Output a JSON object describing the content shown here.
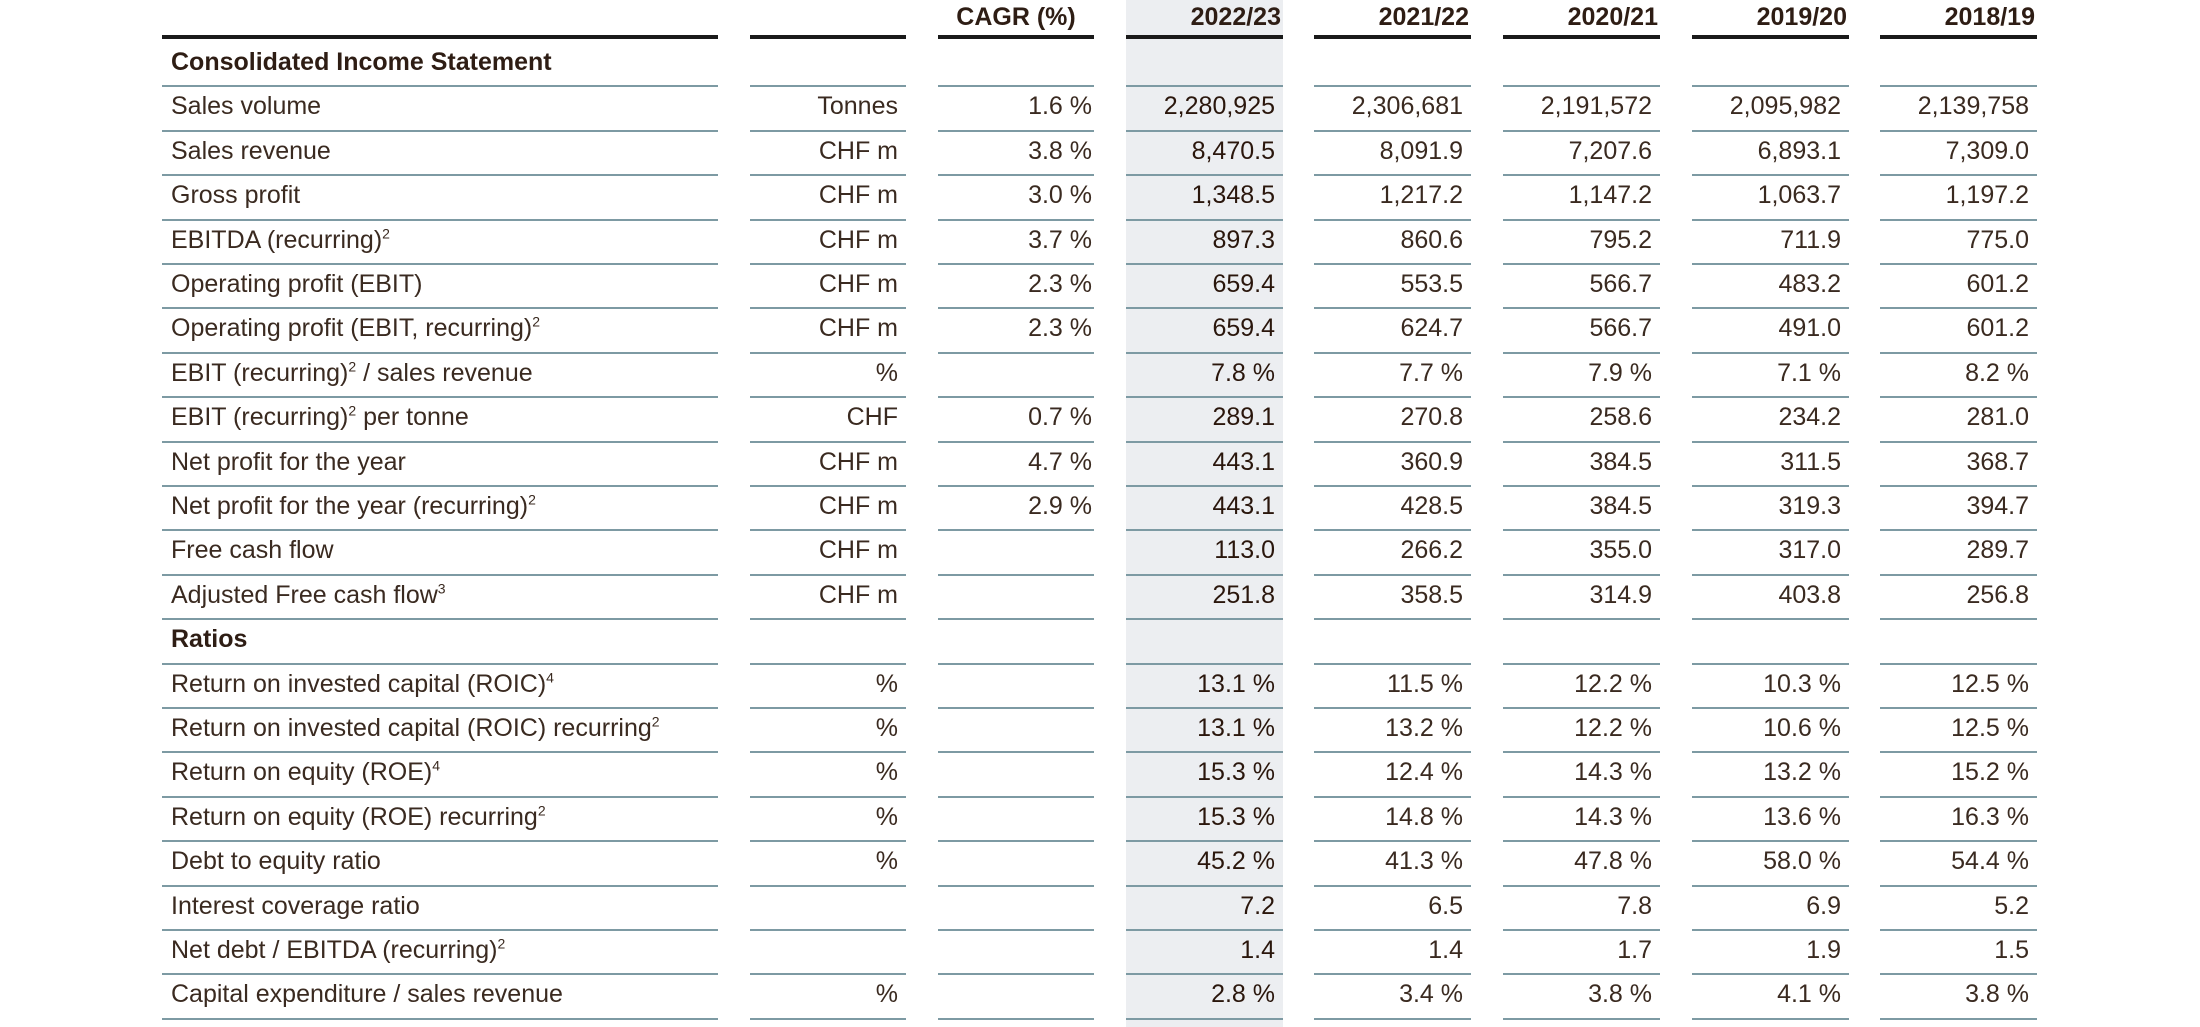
{
  "columns": {
    "cagr": "CAGR (%)",
    "years": [
      "2022/23",
      "2021/22",
      "2020/21",
      "2019/20",
      "2018/19"
    ]
  },
  "rows": [
    {
      "type": "section",
      "label": "Consolidated Income Statement"
    },
    {
      "type": "data",
      "label": "Sales volume",
      "sup": "",
      "unit": "Tonnes",
      "cagr": "1.6 %",
      "values": [
        "2,280,925",
        "2,306,681",
        "2,191,572",
        "2,095,982",
        "2,139,758"
      ]
    },
    {
      "type": "data",
      "label": "Sales revenue",
      "sup": "",
      "unit": "CHF m",
      "cagr": "3.8 %",
      "values": [
        "8,470.5",
        "8,091.9",
        "7,207.6",
        "6,893.1",
        "7,309.0"
      ]
    },
    {
      "type": "data",
      "label": "Gross profit",
      "sup": "",
      "unit": "CHF m",
      "cagr": "3.0 %",
      "values": [
        "1,348.5",
        "1,217.2",
        "1,147.2",
        "1,063.7",
        "1,197.2"
      ]
    },
    {
      "type": "data",
      "label": "EBITDA (recurring)",
      "sup": "2",
      "unit": "CHF m",
      "cagr": "3.7 %",
      "values": [
        "897.3",
        "860.6",
        "795.2",
        "711.9",
        "775.0"
      ]
    },
    {
      "type": "data",
      "label": "Operating profit (EBIT)",
      "sup": "",
      "unit": "CHF m",
      "cagr": "2.3 %",
      "values": [
        "659.4",
        "553.5",
        "566.7",
        "483.2",
        "601.2"
      ]
    },
    {
      "type": "data",
      "label": "Operating profit (EBIT, recurring)",
      "sup": "2",
      "unit": "CHF m",
      "cagr": "2.3 %",
      "values": [
        "659.4",
        "624.7",
        "566.7",
        "491.0",
        "601.2"
      ]
    },
    {
      "type": "data",
      "label": "EBIT (recurring)",
      "sup": "2",
      "label_suffix": " / sales revenue",
      "unit": "%",
      "cagr": "",
      "values": [
        "7.8 %",
        "7.7 %",
        "7.9 %",
        "7.1 %",
        "8.2 %"
      ]
    },
    {
      "type": "data",
      "label": "EBIT (recurring)",
      "sup": "2",
      "label_suffix": " per tonne",
      "unit": "CHF",
      "cagr": "0.7 %",
      "values": [
        "289.1",
        "270.8",
        "258.6",
        "234.2",
        "281.0"
      ]
    },
    {
      "type": "data",
      "label": "Net profit for the year",
      "sup": "",
      "unit": "CHF m",
      "cagr": "4.7 %",
      "values": [
        "443.1",
        "360.9",
        "384.5",
        "311.5",
        "368.7"
      ]
    },
    {
      "type": "data",
      "label": "Net profit for the year (recurring)",
      "sup": "2",
      "unit": "CHF m",
      "cagr": "2.9 %",
      "values": [
        "443.1",
        "428.5",
        "384.5",
        "319.3",
        "394.7"
      ]
    },
    {
      "type": "data",
      "label": "Free cash flow",
      "sup": "",
      "unit": "CHF m",
      "cagr": "",
      "values": [
        "113.0",
        "266.2",
        "355.0",
        "317.0",
        "289.7"
      ]
    },
    {
      "type": "data",
      "label": "Adjusted Free cash flow",
      "sup": "3",
      "unit": "CHF m",
      "cagr": "",
      "values": [
        "251.8",
        "358.5",
        "314.9",
        "403.8",
        "256.8"
      ]
    },
    {
      "type": "section",
      "label": "Ratios"
    },
    {
      "type": "data",
      "label": "Return on invested capital (ROIC)",
      "sup": "4",
      "unit": "%",
      "cagr": "",
      "values": [
        "13.1 %",
        "11.5 %",
        "12.2 %",
        "10.3 %",
        "12.5 %"
      ]
    },
    {
      "type": "data",
      "label": "Return on invested capital (ROIC) recurring",
      "sup": "2",
      "unit": "%",
      "cagr": "",
      "values": [
        "13.1 %",
        "13.2 %",
        "12.2 %",
        "10.6 %",
        "12.5 %"
      ]
    },
    {
      "type": "data",
      "label": "Return on equity (ROE)",
      "sup": "4",
      "unit": "%",
      "cagr": "",
      "values": [
        "15.3 %",
        "12.4 %",
        "14.3 %",
        "13.2 %",
        "15.2 %"
      ]
    },
    {
      "type": "data",
      "label": "Return on equity (ROE) recurring",
      "sup": "2",
      "unit": "%",
      "cagr": "",
      "values": [
        "15.3 %",
        "14.8 %",
        "14.3 %",
        "13.6 %",
        "16.3 %"
      ]
    },
    {
      "type": "data",
      "label": "Debt to equity ratio",
      "sup": "",
      "unit": "%",
      "cagr": "",
      "values": [
        "45.2 %",
        "41.3 %",
        "47.8 %",
        "58.0 %",
        "54.4 %"
      ]
    },
    {
      "type": "data",
      "label": "Interest coverage ratio",
      "sup": "",
      "unit": "",
      "cagr": "",
      "values": [
        "7.2",
        "6.5",
        "7.8",
        "6.9",
        "5.2"
      ]
    },
    {
      "type": "data",
      "label": "Net debt / EBITDA (recurring)",
      "sup": "2",
      "unit": "",
      "cagr": "",
      "values": [
        "1.4",
        "1.4",
        "1.7",
        "1.9",
        "1.5"
      ]
    },
    {
      "type": "data",
      "label": "Capital expenditure / sales revenue",
      "sup": "",
      "unit": "%",
      "cagr": "",
      "values": [
        "2.8 %",
        "3.4 %",
        "3.8 %",
        "4.1 %",
        "3.8 %"
      ]
    }
  ]
}
